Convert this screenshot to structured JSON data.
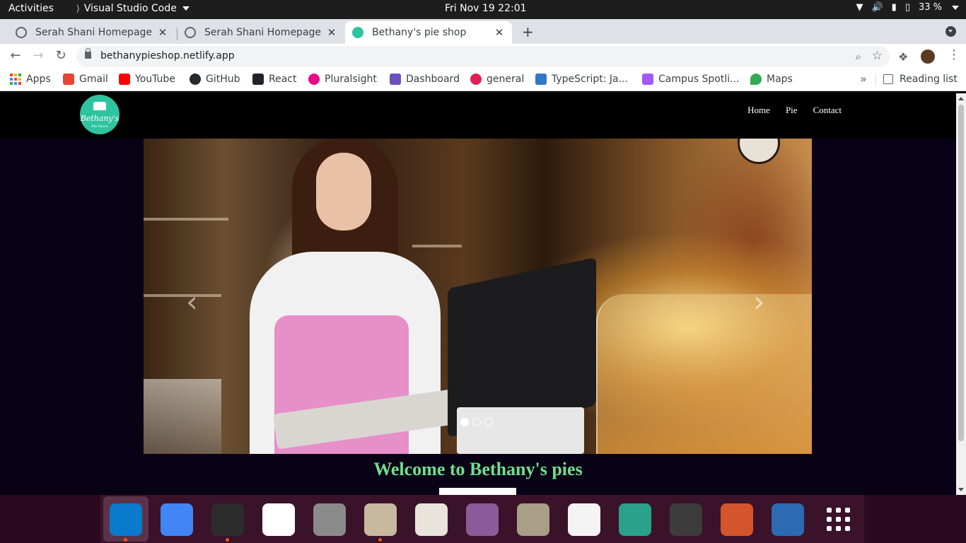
{
  "topbar": {
    "activities": "Activities",
    "app_name": "Visual Studio Code",
    "clock": "Fri Nov 19  22:01",
    "battery": "33 %"
  },
  "tabs": [
    {
      "title": "Serah Shani Homepage",
      "active": false
    },
    {
      "title": "Serah Shani Homepage",
      "active": false
    },
    {
      "title": "Bethany's pie shop",
      "active": true
    }
  ],
  "toolbar": {
    "url": "bethanypieshop.netlify.app"
  },
  "bookmarks": [
    {
      "label": "Apps",
      "icon": "apps-grid-icon"
    },
    {
      "label": "Gmail",
      "icon": "gmail-icon",
      "color": "#ea4335"
    },
    {
      "label": "YouTube",
      "icon": "youtube-icon",
      "color": "#ff0000"
    },
    {
      "label": "GitHub",
      "icon": "github-icon",
      "color": "#24292e"
    },
    {
      "label": "React",
      "icon": "react-icon",
      "color": "#20232a"
    },
    {
      "label": "Pluralsight",
      "icon": "pluralsight-icon",
      "color": "#e80a89"
    },
    {
      "label": "Dashboard",
      "icon": "dashboard-icon",
      "color": "#6b4fbb"
    },
    {
      "label": "general",
      "icon": "slack-general-icon",
      "color": "#e01e5a"
    },
    {
      "label": "TypeScript: Ja...",
      "icon": "typescript-icon",
      "color": "#3178c6"
    },
    {
      "label": "Campus Spotli...",
      "icon": "figma-icon",
      "color": "#a259ff"
    },
    {
      "label": "Maps",
      "icon": "maps-icon",
      "color": "#34a853"
    }
  ],
  "reading_list": "Reading list",
  "site": {
    "logo_text": "Bethany's",
    "logo_sub": "Pie Store",
    "nav": [
      "Home",
      "Pie",
      "Contact"
    ],
    "welcome": "Welcome to Bethany's pies",
    "carousel_slide_count": 3,
    "carousel_active_index": 0
  },
  "dock": [
    {
      "name": "vscode",
      "color": "#0a7acc",
      "running": true
    },
    {
      "name": "chrome",
      "color": "#4285f4",
      "running": false
    },
    {
      "name": "terminal",
      "color": "#2c2c2c",
      "running": true
    },
    {
      "name": "slack",
      "color": "#ffffff",
      "running": false
    },
    {
      "name": "settings",
      "color": "#8a8a8a",
      "running": false
    },
    {
      "name": "files",
      "color": "#c8b8a0",
      "running": true
    },
    {
      "name": "impress-viewer",
      "color": "#e8e4dc",
      "running": false
    },
    {
      "name": "tweaks",
      "color": "#8a5a9a",
      "running": false
    },
    {
      "name": "archive",
      "color": "#a99e86",
      "running": false
    },
    {
      "name": "text-editor",
      "color": "#f4f4f4",
      "running": false
    },
    {
      "name": "remote-desktop",
      "color": "#2aa18a",
      "running": false
    },
    {
      "name": "system-monitor",
      "color": "#3c3c3c",
      "running": false
    },
    {
      "name": "libreoffice-impress",
      "color": "#d4552b",
      "running": false
    },
    {
      "name": "libreoffice-writer",
      "color": "#2a6bb4",
      "running": false
    }
  ],
  "colors": {
    "page_bg": "#090216",
    "welcome_text": "#6fe08c",
    "logo_bg": "#2ec4a0",
    "dock_bg": "#2b0a1f"
  }
}
